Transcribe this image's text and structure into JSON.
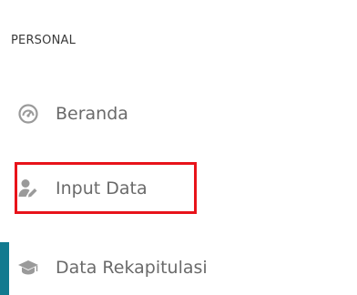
{
  "sidebar": {
    "section_title": "PERSONAL",
    "items": [
      {
        "label": "Beranda",
        "icon": "dashboard-gauge-icon"
      },
      {
        "label": "Input Data",
        "icon": "user-edit-icon"
      },
      {
        "label": "Data Rekapitulasi",
        "icon": "graduation-cap-icon"
      }
    ]
  },
  "colors": {
    "highlight": "#e8131a",
    "active_indicator": "#127a8f",
    "label_text": "#6a6a6a",
    "icon_gray": "#9a9a9a"
  }
}
